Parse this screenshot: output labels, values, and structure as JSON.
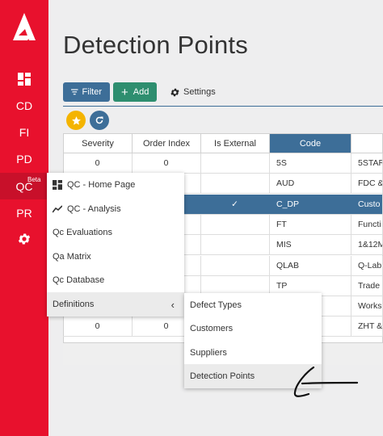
{
  "sidebar": {
    "logo_icon": "brand-a-logo",
    "items": [
      {
        "label": "",
        "icon": "dashboard-icon"
      },
      {
        "label": "CD"
      },
      {
        "label": "FI"
      },
      {
        "label": "PD"
      },
      {
        "label": "QC",
        "badge": "Beta"
      },
      {
        "label": "PR"
      },
      {
        "label": "",
        "icon": "gear-icon"
      }
    ]
  },
  "page": {
    "title": "Detection Points"
  },
  "toolbar": {
    "filter_label": "Filter",
    "add_label": "Add",
    "settings_label": "Settings"
  },
  "table": {
    "columns": [
      "Severity",
      "Order Index",
      "Is External",
      "Code",
      ""
    ],
    "rows": [
      {
        "severity": "0",
        "order": "0",
        "external": "",
        "code": "5S",
        "extra": "5STAR"
      },
      {
        "severity": "",
        "order": "",
        "external": "",
        "code": "AUD",
        "extra": "FDC &"
      },
      {
        "severity": "",
        "order": "",
        "external": "✓",
        "code": "C_DP",
        "extra": "Custo",
        "selected": true
      },
      {
        "severity": "",
        "order": "",
        "external": "",
        "code": "FT",
        "extra": "Functi"
      },
      {
        "severity": "",
        "order": "",
        "external": "",
        "code": "MIS",
        "extra": "1&12M"
      },
      {
        "severity": "",
        "order": "",
        "external": "",
        "code": "QLAB",
        "extra": "Q-Lab"
      },
      {
        "severity": "",
        "order": "",
        "external": "",
        "code": "TP",
        "extra": "Trade"
      },
      {
        "severity": "",
        "order": "",
        "external": "",
        "code": "",
        "extra": "Works"
      },
      {
        "severity": "0",
        "order": "0",
        "external": "",
        "code": "",
        "extra": "ZHT &"
      }
    ]
  },
  "qc_menu": {
    "items": [
      {
        "label": "QC - Home Page",
        "icon": "dashboard-icon"
      },
      {
        "label": "QC - Analysis",
        "icon": "trend-line-icon"
      },
      {
        "label": "Qc Evaluations"
      },
      {
        "label": "Qa Matrix"
      },
      {
        "label": "Qc Database"
      },
      {
        "label": "Definitions",
        "icon": "chevron-left-icon"
      }
    ]
  },
  "definitions_menu": {
    "items": [
      {
        "label": "Defect Types"
      },
      {
        "label": "Customers"
      },
      {
        "label": "Suppliers"
      },
      {
        "label": "Detection Points"
      }
    ]
  },
  "colors": {
    "brand_red": "#e8112d",
    "primary_blue": "#3d6e98",
    "success_green": "#2e8e6f",
    "star_yellow": "#f4b400"
  }
}
